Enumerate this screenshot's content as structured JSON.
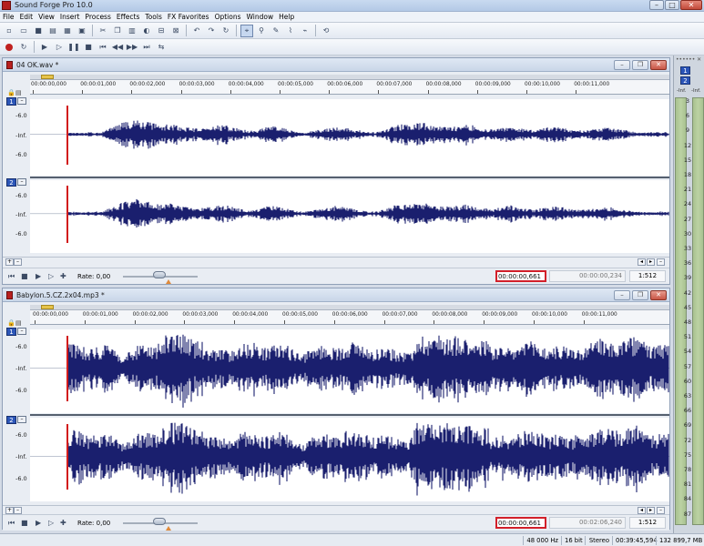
{
  "app": {
    "title": "Sound Forge Pro 10.0"
  },
  "menu": [
    "File",
    "Edit",
    "View",
    "Insert",
    "Process",
    "Effects",
    "Tools",
    "FX Favorites",
    "Options",
    "Window",
    "Help"
  ],
  "master_meter": {
    "channels": [
      "1",
      "2"
    ],
    "peaks": [
      "-Inf.",
      "-Inf."
    ],
    "scale": [
      "3",
      "6",
      "9",
      "12",
      "15",
      "18",
      "21",
      "24",
      "27",
      "30",
      "33",
      "36",
      "39",
      "42",
      "45",
      "48",
      "51",
      "54",
      "57",
      "60",
      "63",
      "66",
      "69",
      "72",
      "75",
      "78",
      "81",
      "84",
      "87"
    ]
  },
  "documents": [
    {
      "name": "04 OK.wav *",
      "ruler": [
        "00:00:00,000",
        "00:00:01,000",
        "00:00:02,000",
        "00:00:03,000",
        "00:00:04,000",
        "00:00:05,000",
        "00:00:06,000",
        "00:00:07,000",
        "00:00:08,000",
        "00:00:09,000",
        "00:00:10,000",
        "00:00:11,000"
      ],
      "channels": [
        {
          "badge": "1",
          "labels": [
            "-6.0",
            "-Inf.",
            "-6.0"
          ]
        },
        {
          "badge": "2",
          "labels": [
            "-6.0",
            "-Inf.",
            "-6.0"
          ]
        }
      ],
      "rate": "Rate: 0,00",
      "cursor_time": "00:00:00,661",
      "length_time": "00:00:00,234",
      "zoom": "1:512"
    },
    {
      "name": "Babylon.5.CZ.2x04.mp3 *",
      "ruler": [
        "00:00:00,000",
        "00:00:01,000",
        "00:00:02,000",
        "00:00:03,000",
        "00:00:04,000",
        "00:00:05,000",
        "00:00:06,000",
        "00:00:07,000",
        "00:00:08,000",
        "00:00:09,000",
        "00:00:10,000",
        "00:00:11,000"
      ],
      "channels": [
        {
          "badge": "1",
          "labels": [
            "-6.0",
            "-Inf.",
            "-6.0"
          ]
        },
        {
          "badge": "2",
          "labels": [
            "-6.0",
            "-Inf.",
            "-6.0"
          ]
        }
      ],
      "rate": "Rate: 0,00",
      "cursor_time": "00:00:00,661",
      "length_time": "00:02:06,240",
      "zoom": "1:512"
    }
  ],
  "status": {
    "sample_rate": "48 000 Hz",
    "bit_depth": "16 bit",
    "channels": "Stereo",
    "length": "00:39:45,594",
    "free_space": "132 899,7 MB"
  },
  "colors": {
    "waveform": "#1a1f6e",
    "playhead": "#d21c1c",
    "highlight": "#d2202a"
  }
}
